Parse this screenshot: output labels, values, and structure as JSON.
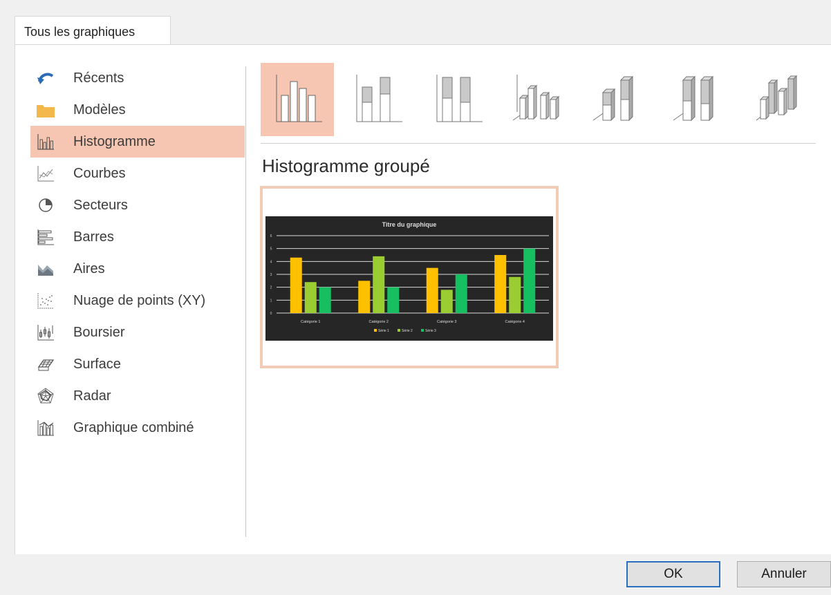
{
  "tabs": [
    {
      "label": "Tous les graphiques",
      "active": true
    }
  ],
  "categories": [
    {
      "label": "Récents",
      "icon": "undo-arrow-icon"
    },
    {
      "label": "Modèles",
      "icon": "folder-icon"
    },
    {
      "label": "Histogramme",
      "icon": "column-chart-icon",
      "selected": true
    },
    {
      "label": "Courbes",
      "icon": "line-chart-icon"
    },
    {
      "label": "Secteurs",
      "icon": "pie-chart-icon"
    },
    {
      "label": "Barres",
      "icon": "bar-chart-icon"
    },
    {
      "label": "Aires",
      "icon": "area-chart-icon"
    },
    {
      "label": "Nuage de points (XY)",
      "icon": "scatter-chart-icon"
    },
    {
      "label": "Boursier",
      "icon": "stock-chart-icon"
    },
    {
      "label": "Surface",
      "icon": "surface-chart-icon"
    },
    {
      "label": "Radar",
      "icon": "radar-chart-icon"
    },
    {
      "label": "Graphique combiné",
      "icon": "combo-chart-icon"
    }
  ],
  "subtypes": [
    {
      "icon": "clustered-column-icon",
      "selected": true
    },
    {
      "icon": "stacked-column-icon"
    },
    {
      "icon": "stacked-100-column-icon"
    },
    {
      "icon": "3d-clustered-column-icon"
    },
    {
      "icon": "3d-stacked-column-icon"
    },
    {
      "icon": "3d-stacked-100-column-icon"
    },
    {
      "icon": "3d-column-icon"
    }
  ],
  "preview": {
    "title": "Histogramme groupé"
  },
  "chart_data": {
    "type": "bar",
    "title": "Titre du graphique",
    "categories": [
      "Catégorie 1",
      "Catégorie 2",
      "Catégorie 3",
      "Catégorie 4"
    ],
    "series": [
      {
        "name": "Série 1",
        "values": [
          4.3,
          2.5,
          3.5,
          4.5
        ],
        "color": "#ffc000"
      },
      {
        "name": "Série 2",
        "values": [
          2.4,
          4.4,
          1.8,
          2.8
        ],
        "color": "#9acd32"
      },
      {
        "name": "Série 3",
        "values": [
          2,
          2,
          3,
          5
        ],
        "color": "#16c060"
      }
    ],
    "ylim": [
      0,
      6
    ],
    "yticks": [
      0,
      1,
      2,
      3,
      4,
      5,
      6
    ],
    "grid": true,
    "legend": "bottom",
    "background": "#262626"
  },
  "buttons": {
    "ok": "OK",
    "cancel": "Annuler"
  },
  "colors": {
    "selection": "#f6c6b2",
    "preview_border": "#f3ccb8",
    "ok_border": "#2a6fbd"
  }
}
